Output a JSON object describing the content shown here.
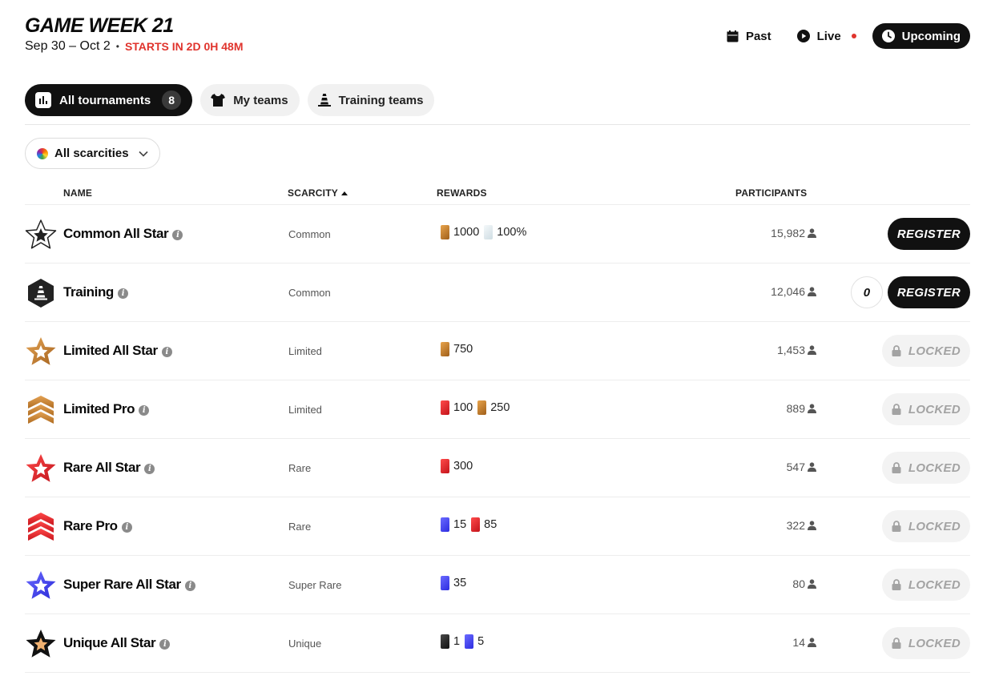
{
  "header": {
    "title": "GAME WEEK 21",
    "dates": "Sep 30 – Oct 2",
    "separator": "•",
    "starts_in": "STARTS IN 2D 0H 48M"
  },
  "time_nav": {
    "past": "Past",
    "live": "Live",
    "upcoming": "Upcoming"
  },
  "tabs": {
    "all_tournaments": "All tournaments",
    "all_tournaments_count": "8",
    "my_teams": "My teams",
    "training_teams": "Training teams"
  },
  "filter": {
    "scarcity_label": "All scarcities"
  },
  "table": {
    "headers": {
      "name": "NAME",
      "scarcity": "SCARCITY",
      "rewards": "REWARDS",
      "participants": "PARTICIPANTS"
    },
    "rows": [
      {
        "name": "Common All Star",
        "scarcity": "Common",
        "rewards": [
          {
            "type": "limited",
            "value": "1000"
          },
          {
            "type": "common",
            "value": "100%"
          }
        ],
        "participants": "15,982",
        "action": "REGISTER",
        "badge_color": "#ffffff"
      },
      {
        "name": "Training",
        "scarcity": "Common",
        "rewards": [],
        "participants": "12,046",
        "action": "REGISTER",
        "team_count": "0",
        "badge_color": "#222222"
      },
      {
        "name": "Limited All Star",
        "scarcity": "Limited",
        "rewards": [
          {
            "type": "limited",
            "value": "750"
          }
        ],
        "participants": "1,453",
        "action": "LOCKED",
        "badge_color": "#c98a35"
      },
      {
        "name": "Limited Pro",
        "scarcity": "Limited",
        "rewards": [
          {
            "type": "rare",
            "value": "100"
          },
          {
            "type": "limited",
            "value": "250"
          }
        ],
        "participants": "889",
        "action": "LOCKED",
        "badge_color": "#c98a35"
      },
      {
        "name": "Rare All Star",
        "scarcity": "Rare",
        "rewards": [
          {
            "type": "rare",
            "value": "300"
          }
        ],
        "participants": "547",
        "action": "LOCKED",
        "badge_color": "#d8222b"
      },
      {
        "name": "Rare Pro",
        "scarcity": "Rare",
        "rewards": [
          {
            "type": "super",
            "value": "15"
          },
          {
            "type": "rare",
            "value": "85"
          }
        ],
        "participants": "322",
        "action": "LOCKED",
        "badge_color": "#d8222b"
      },
      {
        "name": "Super Rare All Star",
        "scarcity": "Super Rare",
        "rewards": [
          {
            "type": "super",
            "value": "35"
          }
        ],
        "participants": "80",
        "action": "LOCKED",
        "badge_color": "#3d46e0"
      },
      {
        "name": "Unique All Star",
        "scarcity": "Unique",
        "rewards": [
          {
            "type": "unique",
            "value": "1"
          },
          {
            "type": "super",
            "value": "5"
          }
        ],
        "participants": "14",
        "action": "LOCKED",
        "badge_color": "#111111"
      }
    ]
  },
  "colors": {
    "accent_red": "#e0342d",
    "dark": "#111111",
    "limited": "#c98a35",
    "rare": "#d8222b",
    "super_rare": "#3d46e0"
  }
}
